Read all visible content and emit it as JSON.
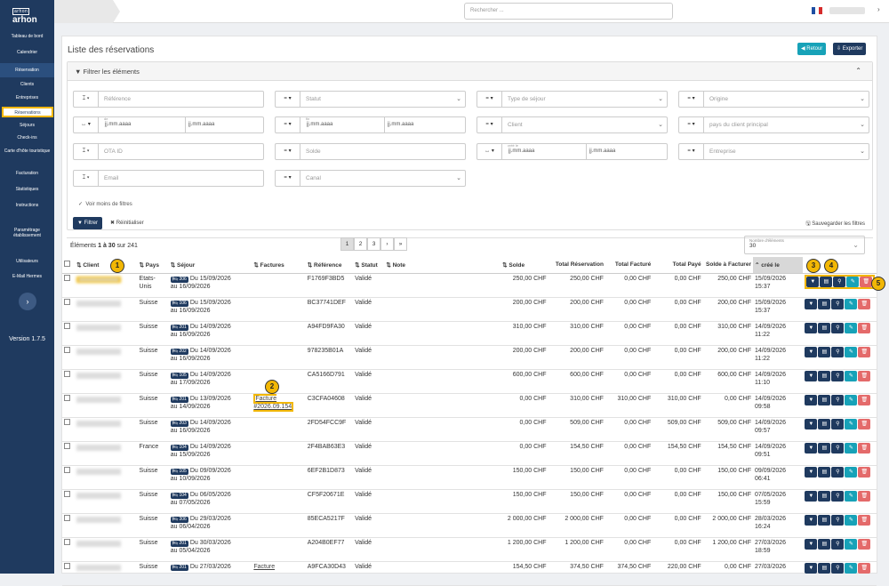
{
  "sidebar": {
    "logo_top": "arhon",
    "logo_main": "arhon",
    "items": [
      {
        "label": "Tableau de bord"
      },
      {
        "label": "Calendrier"
      },
      {
        "label": "Réservation"
      },
      {
        "label": "Clients"
      },
      {
        "label": "Entreprises"
      },
      {
        "label": "Réservations"
      },
      {
        "label": "Séjours"
      },
      {
        "label": "Check-ins"
      },
      {
        "label": "Carte d'hôte touristique"
      },
      {
        "label": "Facturation"
      },
      {
        "label": "Statistiques"
      },
      {
        "label": "Instructions"
      },
      {
        "label": "Paramétrage établissement"
      },
      {
        "label": "Utilisateurs"
      },
      {
        "label": "E-Mail Hermes"
      }
    ],
    "version": "Version 1.7.5"
  },
  "topbar": {
    "search_placeholder": "Rechercher ..."
  },
  "page": {
    "title": "Liste des réservations",
    "retour": "Retour",
    "exporter": "Exporter"
  },
  "filters": {
    "header": "Filtrer les éléments",
    "reference": "Référence",
    "statut": "Statut",
    "type_sejour": "Type de séjour",
    "origine": "Origine",
    "date_ph": "jj.mm.aaaa",
    "de": "de",
    "fin": "fin",
    "cree_le": "créé le",
    "client": "Client",
    "pays_client": "pays du client principal",
    "ota": "OTA ID",
    "solde": "Solde",
    "entreprise": "Entreprise",
    "email": "Email",
    "canal": "Canal",
    "moins": "Voir moins de filtres",
    "filtrer": "Filtrer",
    "reinit": "Réinitialiser",
    "save": "Sauvegarder les filtres"
  },
  "pagination": {
    "count_prefix": "Éléments ",
    "range": "1 à 30",
    "count_suffix": " sur 241",
    "pages": [
      "1",
      "2",
      "3",
      "›",
      "»"
    ],
    "perpage_label": "Nombre d'éléments",
    "perpage": "30"
  },
  "table": {
    "headers": [
      "Client",
      "Pays",
      "Séjour",
      "Factures",
      "Référence",
      "Statut",
      "Note",
      "Solde",
      "Total Réservation",
      "Total Facturé",
      "Total Payé",
      "Solde à Facturer",
      "créé le"
    ],
    "rows": [
      {
        "pays": "Etats-Unis",
        "ch": "306",
        "du": "Du 15/09/2026",
        "au": "au 16/09/2026",
        "fact": "",
        "ref": "F1769F3BD5",
        "statut": "Validé",
        "solde": "250,00 CHF",
        "tr": "250,00 CHF",
        "tf": "0,00 CHF",
        "tp": "0,00 CHF",
        "sf": "250,00 CHF",
        "cd": "15/09/2026",
        "ct": "15:37"
      },
      {
        "pays": "Suisse",
        "ch": "106",
        "du": "Du 15/09/2026",
        "au": "au 16/09/2026",
        "fact": "",
        "ref": "BC37741DEF",
        "statut": "Validé",
        "solde": "200,00 CHF",
        "tr": "200,00 CHF",
        "tf": "0,00 CHF",
        "tp": "0,00 CHF",
        "sf": "200,00 CHF",
        "cd": "15/09/2026",
        "ct": "15:37"
      },
      {
        "pays": "Suisse",
        "ch": "201",
        "du": "Du 14/09/2026",
        "au": "au 16/09/2026",
        "fact": "",
        "ref": "A94FD9FA30",
        "statut": "Validé",
        "solde": "310,00 CHF",
        "tr": "310,00 CHF",
        "tf": "0,00 CHF",
        "tp": "0,00 CHF",
        "sf": "310,00 CHF",
        "cd": "14/09/2026",
        "ct": "11:22"
      },
      {
        "pays": "Suisse",
        "ch": "202",
        "du": "Du 14/09/2026",
        "au": "au 16/09/2026",
        "fact": "",
        "ref": "978235B01A",
        "statut": "Validé",
        "solde": "200,00 CHF",
        "tr": "200,00 CHF",
        "tf": "0,00 CHF",
        "tp": "0,00 CHF",
        "sf": "200,00 CHF",
        "cd": "14/09/2026",
        "ct": "11:22"
      },
      {
        "pays": "Suisse",
        "ch": "105",
        "du": "Du 14/09/2026",
        "au": "au 17/09/2026",
        "fact": "",
        "ref": "CA5166D791",
        "statut": "Validé",
        "solde": "600,00 CHF",
        "tr": "600,00 CHF",
        "tf": "0,00 CHF",
        "tp": "0,00 CHF",
        "sf": "600,00 CHF",
        "cd": "14/09/2026",
        "ct": "11:10"
      },
      {
        "pays": "Suisse",
        "ch": "201",
        "du": "Du 13/09/2026",
        "au": "au 14/09/2026",
        "fact": "Facture #2026.09.154",
        "ref": "C3CFA04608",
        "statut": "Validé",
        "solde": "0,00 CHF",
        "tr": "310,00 CHF",
        "tf": "310,00 CHF",
        "tp": "310,00 CHF",
        "sf": "0,00 CHF",
        "cd": "14/09/2026",
        "ct": "09:58"
      },
      {
        "pays": "Suisse",
        "ch": "203",
        "du": "Du 14/09/2026",
        "au": "au 16/09/2026",
        "fact": "",
        "ref": "2FD54FCC9F",
        "statut": "Validé",
        "solde": "0,00 CHF",
        "tr": "509,00 CHF",
        "tf": "0,00 CHF",
        "tp": "509,00 CHF",
        "sf": "509,00 CHF",
        "cd": "14/09/2026",
        "ct": "09:57"
      },
      {
        "pays": "France",
        "ch": "104",
        "du": "Du 14/09/2026",
        "au": "au 15/09/2026",
        "fact": "",
        "ref": "2F4BAB63E3",
        "statut": "Validé",
        "solde": "0,00 CHF",
        "tr": "154,50 CHF",
        "tf": "0,00 CHF",
        "tp": "154,50 CHF",
        "sf": "154,50 CHF",
        "cd": "14/09/2026",
        "ct": "09:51"
      },
      {
        "pays": "Suisse",
        "ch": "105",
        "du": "Du 09/09/2026",
        "au": "au 10/09/2026",
        "fact": "",
        "ref": "6EF2B1D873",
        "statut": "Validé",
        "solde": "150,00 CHF",
        "tr": "150,00 CHF",
        "tf": "0,00 CHF",
        "tp": "0,00 CHF",
        "sf": "150,00 CHF",
        "cd": "09/09/2026",
        "ct": "06:41"
      },
      {
        "pays": "Suisse",
        "ch": "104",
        "du": "Du 06/05/2026",
        "au": "au 07/05/2026",
        "fact": "",
        "ref": "CF5F20671E",
        "statut": "Validé",
        "solde": "150,00 CHF",
        "tr": "150,00 CHF",
        "tf": "0,00 CHF",
        "tp": "0,00 CHF",
        "sf": "150,00 CHF",
        "cd": "07/05/2026",
        "ct": "15:59"
      },
      {
        "pays": "Suisse",
        "ch": "306",
        "du": "Du 29/03/2026",
        "au": "au 06/04/2026",
        "fact": "",
        "ref": "85ECA5217F",
        "statut": "Validé",
        "solde": "2 000,00 CHF",
        "tr": "2 000,00 CHF",
        "tf": "0,00 CHF",
        "tp": "0,00 CHF",
        "sf": "2 000,00 CHF",
        "cd": "28/03/2026",
        "ct": "16:24"
      },
      {
        "pays": "Suisse",
        "ch": "201",
        "du": "Du 30/03/2026",
        "au": "au 05/04/2026",
        "fact": "",
        "ref": "A204B0EF77",
        "statut": "Validé",
        "solde": "1 200,00 CHF",
        "tr": "1 200,00 CHF",
        "tf": "0,00 CHF",
        "tp": "0,00 CHF",
        "sf": "1 200,00 CHF",
        "cd": "27/03/2026",
        "ct": "18:59"
      },
      {
        "pays": "Suisse",
        "ch": "201",
        "du": "Du 27/03/2026",
        "au": "",
        "fact": "Facture",
        "ref": "A9FCA30D43",
        "statut": "Validé",
        "solde": "154,50 CHF",
        "tr": "374,50 CHF",
        "tf": "374,50 CHF",
        "tp": "220,00 CHF",
        "sf": "0,00 CHF",
        "cd": "27/03/2026",
        "ct": ""
      }
    ]
  },
  "callouts": [
    "1",
    "2",
    "3",
    "4",
    "5"
  ]
}
